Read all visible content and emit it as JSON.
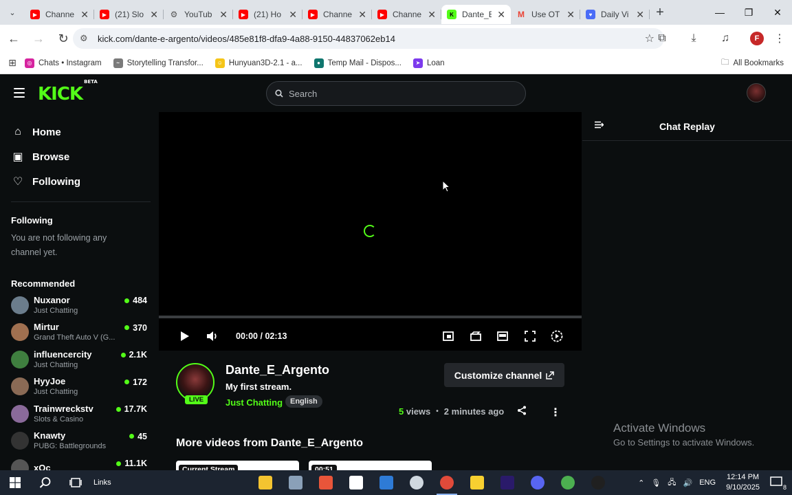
{
  "browser": {
    "tabs": [
      {
        "title": "Channe",
        "favicon": "youtube",
        "color": "#ff0000",
        "active": false
      },
      {
        "title": "(21) Slo",
        "favicon": "youtube",
        "color": "#ff0000",
        "active": false
      },
      {
        "title": "YouTub",
        "favicon": "gear",
        "color": "#555555",
        "active": false
      },
      {
        "title": "(21) Ho",
        "favicon": "youtube",
        "color": "#ff0000",
        "active": false
      },
      {
        "title": "Channe",
        "favicon": "youtube",
        "color": "#ff0000",
        "active": false
      },
      {
        "title": "Channe",
        "favicon": "youtube",
        "color": "#ff0000",
        "active": false
      },
      {
        "title": "Dante_E",
        "favicon": "kick",
        "color": "#53fc18",
        "active": true
      },
      {
        "title": "Use OT",
        "favicon": "gmail",
        "color": "#ea4335",
        "active": false
      },
      {
        "title": "Daily Vi",
        "favicon": "shield",
        "color": "#4a6cf7",
        "active": false
      }
    ],
    "url": "kick.com/dante-e-argento/videos/485e81f8-dfa9-4a88-9150-44837062eb14",
    "profile_initial": "F",
    "bookmarks": [
      {
        "label": "Chats • Instagram",
        "color": "#d6249f",
        "glyph": "◎"
      },
      {
        "label": "Storytelling Transfor...",
        "color": "#7a7a7a",
        "glyph": "~"
      },
      {
        "label": "Hunyuan3D-2.1 - a...",
        "color": "#f5c518",
        "glyph": "☺"
      },
      {
        "label": "Temp Mail - Dispos...",
        "color": "#0f766e",
        "glyph": "●"
      },
      {
        "label": "Loan",
        "color": "#7c3aed",
        "glyph": "➤"
      }
    ],
    "all_bookmarks_label": "All Bookmarks"
  },
  "kick": {
    "logo_text": "KICK",
    "logo_badge": "BETA",
    "search_placeholder": "Search",
    "nav": [
      {
        "label": "Home",
        "icon": "home-icon",
        "glyph": "⌂"
      },
      {
        "label": "Browse",
        "icon": "browse-icon",
        "glyph": "▣"
      },
      {
        "label": "Following",
        "icon": "heart-icon",
        "glyph": "♡"
      }
    ],
    "following_title": "Following",
    "following_empty": "You are not following any channel yet.",
    "recommended_title": "Recommended",
    "recommended": [
      {
        "name": "Nuxanor",
        "category": "Just Chatting",
        "viewers": "484",
        "color": "#6b7d8c"
      },
      {
        "name": "Mirtur",
        "category": "Grand Theft Auto V (G...",
        "viewers": "370",
        "color": "#a07050"
      },
      {
        "name": "influencercity",
        "category": "Just Chatting",
        "viewers": "2.1K",
        "color": "#3f7f3f"
      },
      {
        "name": "HyyJoe",
        "category": "Just Chatting",
        "viewers": "172",
        "color": "#8a6a55"
      },
      {
        "name": "Trainwreckstv",
        "category": "Slots & Casino",
        "viewers": "17.7K",
        "color": "#8a6a9a"
      },
      {
        "name": "Knawty",
        "category": "PUBG: Battlegrounds",
        "viewers": "45",
        "color": "#333333"
      },
      {
        "name": "xQc",
        "category": "",
        "viewers": "11.1K",
        "color": "#555555"
      }
    ],
    "player": {
      "time_current": "00:00",
      "time_separator": "/",
      "time_total": "02:13",
      "progress": 0
    },
    "chat_title": "Chat Replay",
    "channel": {
      "name": "Dante_E_Argento",
      "stream_title": "My first stream.",
      "category": "Just Chatting",
      "language": "English",
      "live_badge": "LIVE",
      "customize_label": "Customize channel",
      "views_count": "5",
      "views_label": "views",
      "dot": "•",
      "time_ago": "2 minutes ago"
    },
    "more_videos_title": "More videos from Dante_E_Argento",
    "thumbnails": [
      {
        "label": "Current Stream"
      },
      {
        "label": "00:51"
      }
    ]
  },
  "watermark": {
    "line1": "Activate Windows",
    "line2": "Go to Settings to activate Windows."
  },
  "taskbar": {
    "links_label": "Links",
    "language": "ENG",
    "time": "12:14 PM",
    "date": "9/10/2025",
    "notifications": "8",
    "apps": [
      {
        "name": "file-explorer",
        "color": "#f4c430"
      },
      {
        "name": "app-globe",
        "color": "#8aa0b8"
      },
      {
        "name": "app-red",
        "color": "#e8553a"
      },
      {
        "name": "app-notes",
        "color": "#ffffff"
      },
      {
        "name": "app-bg",
        "color": "#2e7bd6"
      },
      {
        "name": "app-q",
        "color": "#d0d8e0"
      },
      {
        "name": "chrome",
        "color": "#e04a3a"
      },
      {
        "name": "sticky-notes",
        "color": "#f8d030"
      },
      {
        "name": "premiere",
        "color": "#2a1a6a"
      },
      {
        "name": "discord",
        "color": "#5865f2"
      },
      {
        "name": "utorrent",
        "color": "#4caf50"
      },
      {
        "name": "obs",
        "color": "#202020"
      }
    ]
  }
}
